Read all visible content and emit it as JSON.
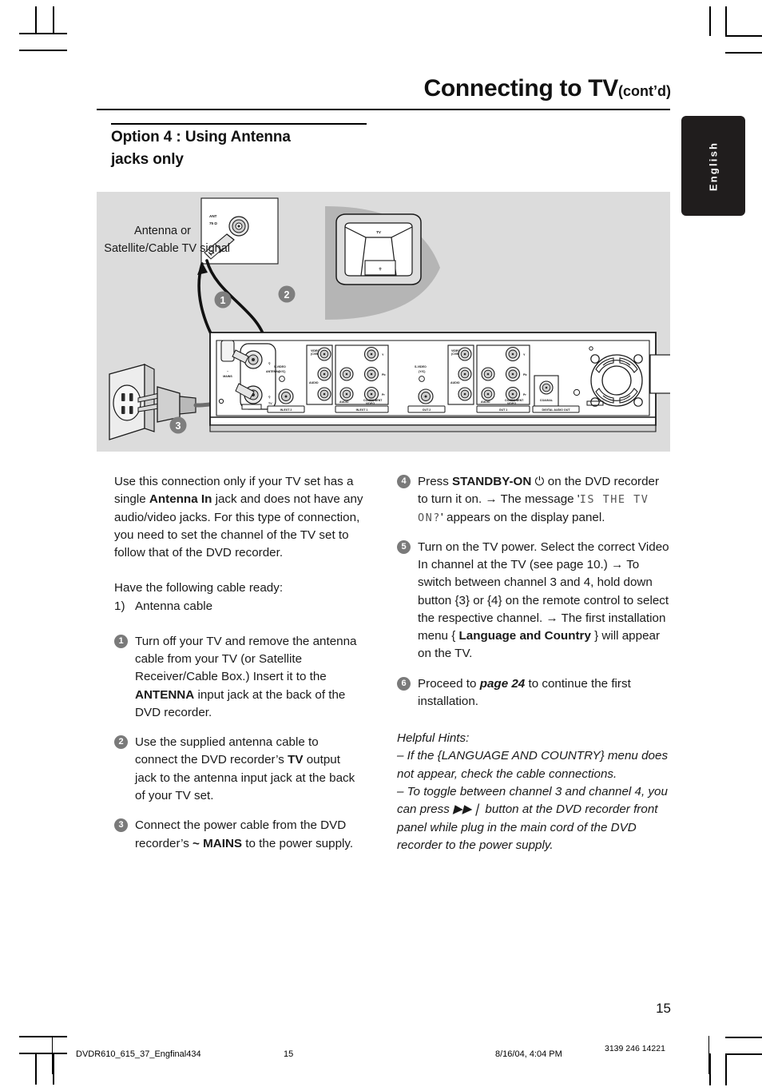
{
  "header": {
    "title": "Connecting to TV",
    "contd": "(cont’d)",
    "language_tab": "English"
  },
  "section": {
    "heading_line1": "Option 4 : Using  Antenna",
    "heading_line2": "jacks only"
  },
  "diagram": {
    "label_antenna_line1": "Antenna or",
    "label_antenna_line2": "Satellite/Cable TV signal",
    "callout_1": "1",
    "callout_2": "2",
    "callout_3": "3",
    "tv_label": "TV",
    "ant_label": "ANT",
    "ant_impedance": "75 Ω",
    "panel_labels": {
      "mains": "MAINS",
      "mains_tilde": "~",
      "antenna": "ANTENNA",
      "tv": "TV",
      "svideo_1": "S-VIDEO",
      "svideo_1_sub": "(Y/C)",
      "svideo_2": "S-VIDEO",
      "svideo_2_sub": "(Y/C)",
      "video_cvbs_1": "VIDEO (CVBS)",
      "video_cvbs_2": "VIDEO (CVBS)",
      "audio_1": "AUDIO",
      "audio_2": "AUDIO",
      "audio_3": "AUDIO",
      "audio_4": "AUDIO",
      "component_video_1": "COMPONENT VIDEO",
      "component_video_2": "COMPONENT VIDEO",
      "y1": "Y",
      "pb1": "Pb",
      "pr1": "Pr",
      "y2": "Y",
      "pb2": "Pb",
      "pr2": "Pr",
      "coaxial": "COAXIAL",
      "in_ext_2": "IN-EXT 2",
      "in_ext_1": "IN-EXT 1",
      "out_2": "OUT 2",
      "out_1": "OUT 1",
      "digital_audio_out": "DIGITAL AUDIO OUT"
    }
  },
  "left_column": {
    "intro": "Use this connection only if your TV set has a single <b>Antenna In</b> jack and does not have any audio/video jacks. For this type of connection, you need to set the channel of the TV set to follow that of the DVD recorder.",
    "cable_ready": "Have the following cable ready:",
    "cable_item_num": "1)",
    "cable_item": "Antenna cable",
    "step1_num": "1",
    "step1": "Turn off your TV and remove the antenna cable from your TV (or Satellite Receiver/Cable Box.)  Insert it to the <b>ANTENNA</b> input jack at the back of the DVD recorder.",
    "step2_num": "2",
    "step2": "Use the supplied antenna cable to connect the DVD recorder’s <b>TV</b> output jack to the antenna input jack at the back of your TV set.",
    "step3_num": "3",
    "step3": "Connect the power cable from the DVD recorder’s <b>~ MAINS</b> to the power supply."
  },
  "right_column": {
    "step4_num": "4",
    "step4": "Press <b>STANDBY-ON</b> ⏻ on the DVD recorder to turn it on.",
    "step4_arrow": "→ The message '<span class=\"lcd\">IS THE TV ON?</span>' appears on the display panel.",
    "step5_num": "5",
    "step5": "Turn on the TV power.  Select the correct Video In channel at the TV (see page 10.)",
    "step5_arrow1": "→ To switch between channel 3 and 4, hold down button {3} or {4} on the remote control to select the respective channel.",
    "step5_arrow2": "→ The first installation menu { <b>Language and Country</b> } will appear on the TV.",
    "step6_num": "6",
    "step6": "Proceed to <b><i>page 24</i></b> to continue the first installation.",
    "hints_title": "Helpful Hints:",
    "hint1": "–  If the {LANGUAGE AND COUNTRY} menu does not appear, check the cable connections.",
    "hint2": "–  To toggle between channel 3 and channel 4, you can press ▶▶❘ button at the DVD recorder front panel while plug in the main cord of the DVD recorder to the power supply."
  },
  "footer": {
    "page_number": "15",
    "file_name": "DVDR610_615_37_Engfinal434",
    "footer_page": "15",
    "date": "8/16/04, 4:04 PM",
    "doc_code": "3139 246 14221"
  },
  "colors": {
    "diagram_bg": "#dcdcdc",
    "tab_bg": "#201d1d",
    "bullet": "#7a7a7a",
    "text": "#1a1a1a"
  }
}
